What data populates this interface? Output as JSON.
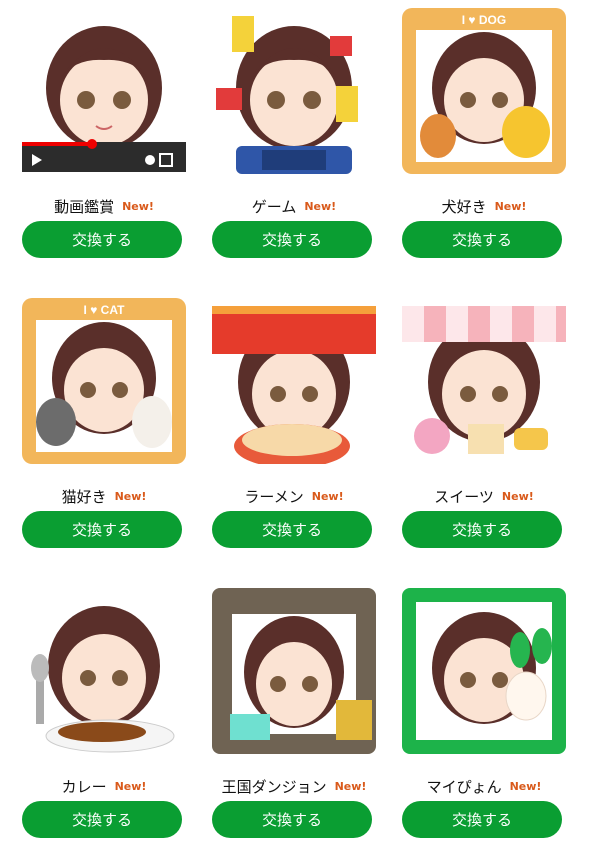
{
  "items": [
    {
      "title": "動画鑑賞",
      "badge": "New!",
      "button": "交換する",
      "icon": "video-viewing-icon"
    },
    {
      "title": "ゲーム",
      "badge": "New!",
      "button": "交換する",
      "icon": "game-icon"
    },
    {
      "title": "犬好き",
      "badge": "New!",
      "button": "交換する",
      "icon": "dog-lover-icon",
      "frame_text": "I ♥ DOG"
    },
    {
      "title": "猫好き",
      "badge": "New!",
      "button": "交換する",
      "icon": "cat-lover-icon",
      "frame_text": "I ♥ CAT"
    },
    {
      "title": "ラーメン",
      "badge": "New!",
      "button": "交換する",
      "icon": "ramen-icon"
    },
    {
      "title": "スイーツ",
      "badge": "New!",
      "button": "交換する",
      "icon": "sweets-icon"
    },
    {
      "title": "カレー",
      "badge": "New!",
      "button": "交換する",
      "icon": "curry-icon"
    },
    {
      "title": "王国ダンジョン",
      "badge": "New!",
      "button": "交換する",
      "icon": "kingdom-dungeon-icon"
    },
    {
      "title": "マイぴょん",
      "badge": "New!",
      "button": "交換する",
      "icon": "my-pyon-icon"
    }
  ],
  "colors": {
    "button": "#0a9e32",
    "badge": "#d95a1b",
    "frame_orange": "#f2b65a",
    "frame_green": "#1db34a"
  }
}
